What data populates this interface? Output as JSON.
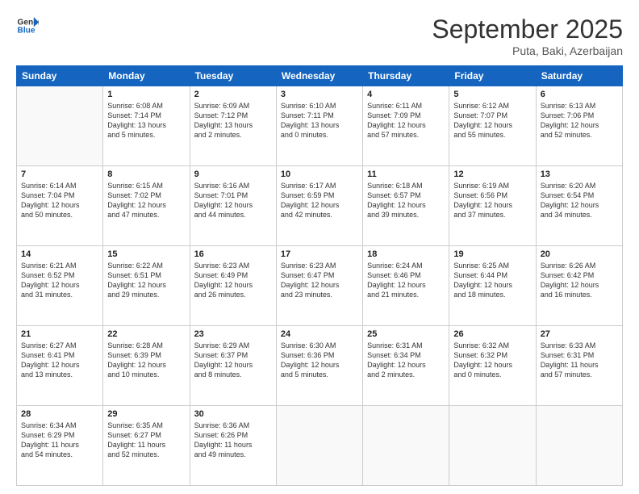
{
  "logo": {
    "line1": "General",
    "line2": "Blue"
  },
  "title": "September 2025",
  "subtitle": "Puta, Baki, Azerbaijan",
  "header_days": [
    "Sunday",
    "Monday",
    "Tuesday",
    "Wednesday",
    "Thursday",
    "Friday",
    "Saturday"
  ],
  "weeks": [
    [
      {
        "day": "",
        "data": ""
      },
      {
        "day": "1",
        "data": "Sunrise: 6:08 AM\nSunset: 7:14 PM\nDaylight: 13 hours\nand 5 minutes."
      },
      {
        "day": "2",
        "data": "Sunrise: 6:09 AM\nSunset: 7:12 PM\nDaylight: 13 hours\nand 2 minutes."
      },
      {
        "day": "3",
        "data": "Sunrise: 6:10 AM\nSunset: 7:11 PM\nDaylight: 13 hours\nand 0 minutes."
      },
      {
        "day": "4",
        "data": "Sunrise: 6:11 AM\nSunset: 7:09 PM\nDaylight: 12 hours\nand 57 minutes."
      },
      {
        "day": "5",
        "data": "Sunrise: 6:12 AM\nSunset: 7:07 PM\nDaylight: 12 hours\nand 55 minutes."
      },
      {
        "day": "6",
        "data": "Sunrise: 6:13 AM\nSunset: 7:06 PM\nDaylight: 12 hours\nand 52 minutes."
      }
    ],
    [
      {
        "day": "7",
        "data": "Sunrise: 6:14 AM\nSunset: 7:04 PM\nDaylight: 12 hours\nand 50 minutes."
      },
      {
        "day": "8",
        "data": "Sunrise: 6:15 AM\nSunset: 7:02 PM\nDaylight: 12 hours\nand 47 minutes."
      },
      {
        "day": "9",
        "data": "Sunrise: 6:16 AM\nSunset: 7:01 PM\nDaylight: 12 hours\nand 44 minutes."
      },
      {
        "day": "10",
        "data": "Sunrise: 6:17 AM\nSunset: 6:59 PM\nDaylight: 12 hours\nand 42 minutes."
      },
      {
        "day": "11",
        "data": "Sunrise: 6:18 AM\nSunset: 6:57 PM\nDaylight: 12 hours\nand 39 minutes."
      },
      {
        "day": "12",
        "data": "Sunrise: 6:19 AM\nSunset: 6:56 PM\nDaylight: 12 hours\nand 37 minutes."
      },
      {
        "day": "13",
        "data": "Sunrise: 6:20 AM\nSunset: 6:54 PM\nDaylight: 12 hours\nand 34 minutes."
      }
    ],
    [
      {
        "day": "14",
        "data": "Sunrise: 6:21 AM\nSunset: 6:52 PM\nDaylight: 12 hours\nand 31 minutes."
      },
      {
        "day": "15",
        "data": "Sunrise: 6:22 AM\nSunset: 6:51 PM\nDaylight: 12 hours\nand 29 minutes."
      },
      {
        "day": "16",
        "data": "Sunrise: 6:23 AM\nSunset: 6:49 PM\nDaylight: 12 hours\nand 26 minutes."
      },
      {
        "day": "17",
        "data": "Sunrise: 6:23 AM\nSunset: 6:47 PM\nDaylight: 12 hours\nand 23 minutes."
      },
      {
        "day": "18",
        "data": "Sunrise: 6:24 AM\nSunset: 6:46 PM\nDaylight: 12 hours\nand 21 minutes."
      },
      {
        "day": "19",
        "data": "Sunrise: 6:25 AM\nSunset: 6:44 PM\nDaylight: 12 hours\nand 18 minutes."
      },
      {
        "day": "20",
        "data": "Sunrise: 6:26 AM\nSunset: 6:42 PM\nDaylight: 12 hours\nand 16 minutes."
      }
    ],
    [
      {
        "day": "21",
        "data": "Sunrise: 6:27 AM\nSunset: 6:41 PM\nDaylight: 12 hours\nand 13 minutes."
      },
      {
        "day": "22",
        "data": "Sunrise: 6:28 AM\nSunset: 6:39 PM\nDaylight: 12 hours\nand 10 minutes."
      },
      {
        "day": "23",
        "data": "Sunrise: 6:29 AM\nSunset: 6:37 PM\nDaylight: 12 hours\nand 8 minutes."
      },
      {
        "day": "24",
        "data": "Sunrise: 6:30 AM\nSunset: 6:36 PM\nDaylight: 12 hours\nand 5 minutes."
      },
      {
        "day": "25",
        "data": "Sunrise: 6:31 AM\nSunset: 6:34 PM\nDaylight: 12 hours\nand 2 minutes."
      },
      {
        "day": "26",
        "data": "Sunrise: 6:32 AM\nSunset: 6:32 PM\nDaylight: 12 hours\nand 0 minutes."
      },
      {
        "day": "27",
        "data": "Sunrise: 6:33 AM\nSunset: 6:31 PM\nDaylight: 11 hours\nand 57 minutes."
      }
    ],
    [
      {
        "day": "28",
        "data": "Sunrise: 6:34 AM\nSunset: 6:29 PM\nDaylight: 11 hours\nand 54 minutes."
      },
      {
        "day": "29",
        "data": "Sunrise: 6:35 AM\nSunset: 6:27 PM\nDaylight: 11 hours\nand 52 minutes."
      },
      {
        "day": "30",
        "data": "Sunrise: 6:36 AM\nSunset: 6:26 PM\nDaylight: 11 hours\nand 49 minutes."
      },
      {
        "day": "",
        "data": ""
      },
      {
        "day": "",
        "data": ""
      },
      {
        "day": "",
        "data": ""
      },
      {
        "day": "",
        "data": ""
      }
    ]
  ]
}
